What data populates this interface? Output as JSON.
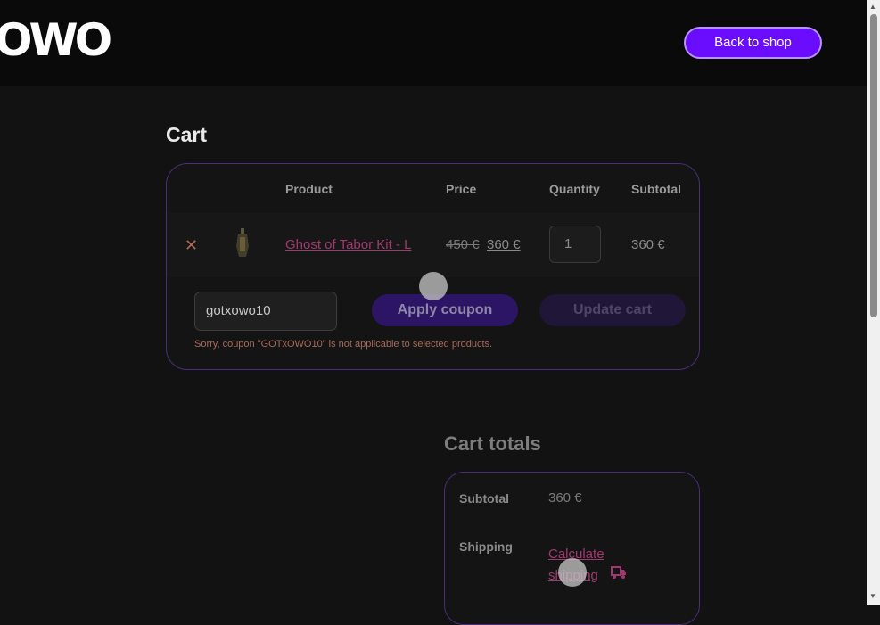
{
  "header": {
    "logo_text": "OWO",
    "back_button": "Back to shop"
  },
  "cart": {
    "title": "Cart",
    "columns": [
      "Product",
      "Price",
      "Quantity",
      "Subtotal"
    ],
    "items": [
      {
        "remove_symbol": "✕",
        "name": "Ghost of Tabor Kit - L",
        "price_old": "450 €",
        "price_new": "360 €",
        "quantity": "1",
        "subtotal": "360 €"
      }
    ],
    "coupon_value": "gotxowo10",
    "apply_label": "Apply coupon",
    "update_label": "Update cart",
    "coupon_error": "Sorry, coupon \"GOTxOWO10\" is not applicable to selected products."
  },
  "totals": {
    "title": "Cart totals",
    "subtotal_label": "Subtotal",
    "subtotal_value": "360 €",
    "shipping_label": "Shipping",
    "shipping_link": "Calculate shipping"
  },
  "colors": {
    "accent": "#6a0dff",
    "link": "#a03a6e",
    "card_border": "#4a2f7a",
    "error": "#a86b58"
  }
}
